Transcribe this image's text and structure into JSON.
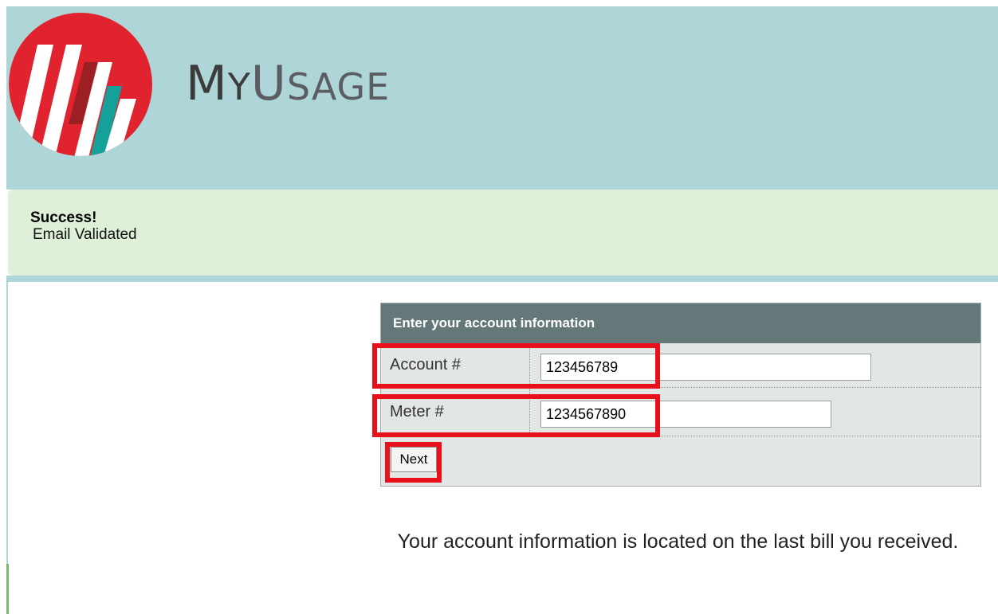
{
  "brand": {
    "my_first": "M",
    "my_rest": "Y",
    "usage_first": "U",
    "usage_rest": "SAGE",
    "logo_icon": "bar-chart-logo-icon",
    "colors": {
      "header_bg": "#aed5d7",
      "logo_red": "#e0232f",
      "logo_teal": "#16a09a",
      "logo_white": "#ffffff"
    }
  },
  "alert": {
    "title": "Success!",
    "message": "Email Validated",
    "bg_color": "#dff0d8"
  },
  "form": {
    "heading": "Enter your account information",
    "account_label": "Account #",
    "account_value": "123456789",
    "meter_label": "Meter #",
    "meter_value": "1234567890",
    "next_label": "Next",
    "header_color": "#657879",
    "highlight_color": "#e8101a"
  },
  "info": {
    "text": "Your account information is located on the last bill you received."
  }
}
